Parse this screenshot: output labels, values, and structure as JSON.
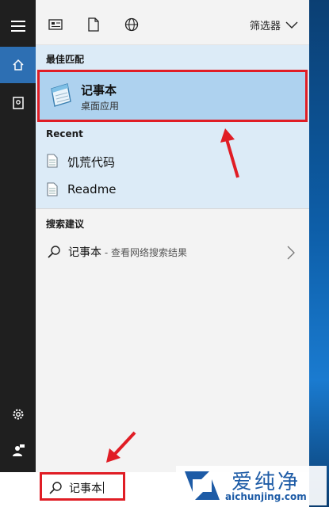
{
  "toolbar": {
    "filter_label": "筛选器",
    "icons": [
      "app-icon",
      "document-icon",
      "globe-icon"
    ]
  },
  "best_match": {
    "section_title": "最佳匹配",
    "name": "记事本",
    "subtitle": "桌面应用"
  },
  "recent": {
    "section_title": "Recent",
    "items": [
      {
        "label": "饥荒代码"
      },
      {
        "label": "Readme"
      }
    ]
  },
  "suggestions": {
    "section_title": "搜索建议",
    "query": "记事本",
    "hint": " - 查看网络搜索结果"
  },
  "search": {
    "value": "记事本"
  },
  "watermark": {
    "title": "爱纯净",
    "url": "aichunjing.com"
  },
  "colors": {
    "highlight_border": "#e01d25",
    "best_match_bg": "#aed2ef",
    "section_bg": "#dcebf7",
    "rail_active": "#2d6fb3",
    "arrow": "#e01d25"
  }
}
